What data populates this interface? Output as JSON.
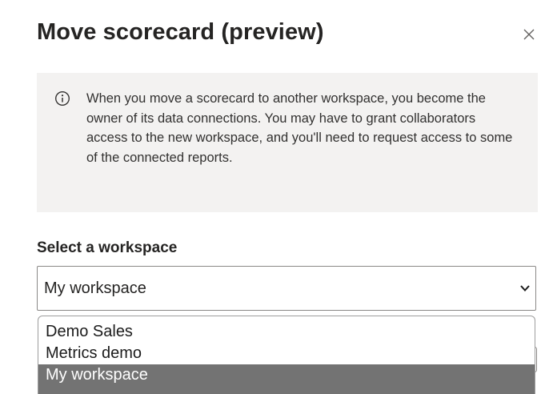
{
  "dialog": {
    "title": "Move scorecard (preview)",
    "close_icon": "close-icon"
  },
  "info_message": {
    "icon": "info-icon",
    "text": "When you move a scorecard to another workspace, you become the owner of its data connections. You may have to grant collaborators access to the new workspace, and you'll need to request access to some of the connected reports."
  },
  "workspace_select": {
    "label": "Select a workspace",
    "value": "My workspace",
    "chevron_icon": "chevron-down-icon",
    "options": [
      {
        "label": "Demo Sales",
        "selected": false
      },
      {
        "label": "Metrics demo",
        "selected": false
      },
      {
        "label": "My workspace",
        "selected": true
      }
    ]
  },
  "colors": {
    "info_background": "#f3f2f1",
    "selected_option_background": "#737373",
    "border": "#8a8886",
    "text": "#252423"
  }
}
